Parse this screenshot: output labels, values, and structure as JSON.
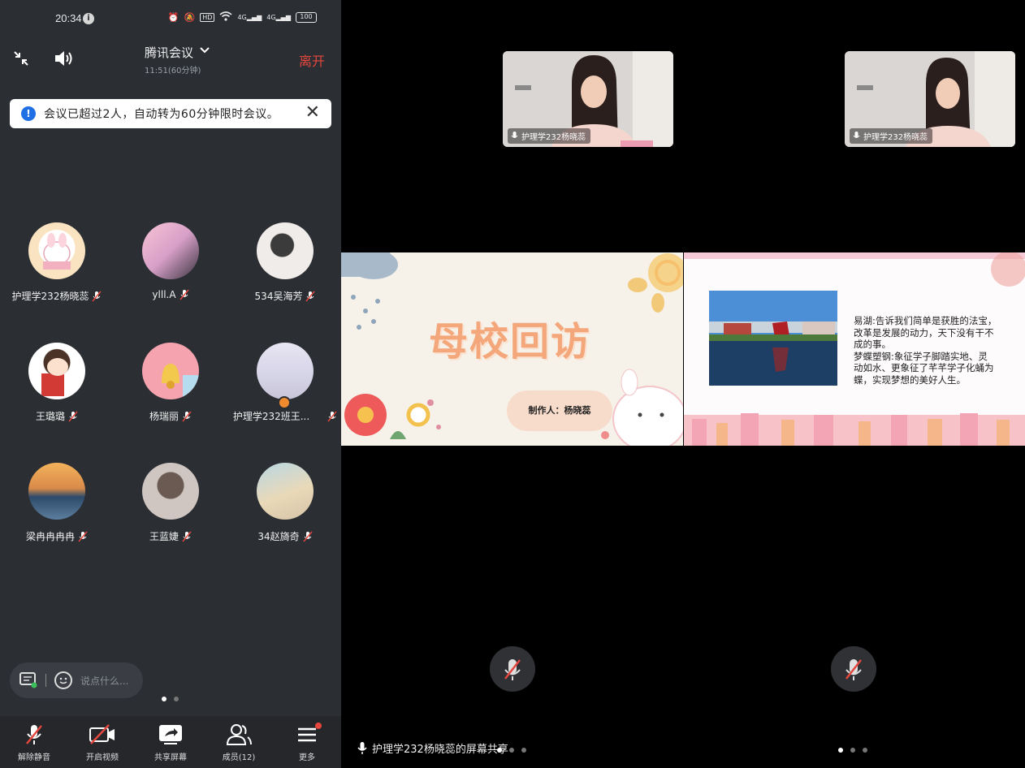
{
  "status_bar": {
    "time": "20:34",
    "hd": "HD",
    "net1": "4G",
    "net2": "4G",
    "battery": "100"
  },
  "header": {
    "title": "腾讯会议",
    "duration": "11:51(60分钟)",
    "leave_label": "离开"
  },
  "notice": {
    "text": "会议已超过2人，自动转为60分钟限时会议。"
  },
  "members": [
    {
      "name": "护理学232杨晓蕊"
    },
    {
      "name": "ylll.A"
    },
    {
      "name": "534吴海芳"
    },
    {
      "name": "王璐璐"
    },
    {
      "name": "杨瑞丽"
    },
    {
      "name": "护理学232班王..."
    },
    {
      "name": "梁冉冉冉冉"
    },
    {
      "name": "王蓝婕"
    },
    {
      "name": "34赵旖奇"
    }
  ],
  "chat": {
    "placeholder": "说点什么..."
  },
  "toolbar": {
    "unmute": "解除静音",
    "video": "开启视频",
    "share": "共享屏幕",
    "members": "成员(12)",
    "more": "更多"
  },
  "video_tiles": [
    {
      "label": "护理学232杨晓蕊"
    },
    {
      "label": "护理学232杨晓蕊"
    }
  ],
  "slides": {
    "left": {
      "title": "母校回访",
      "maker": "制作人：杨晓蕊"
    },
    "right": {
      "text_lines": [
        "易湖:告诉我们简单是获胜的法宝，",
        "改革是发展的动力，天下没有干不",
        "成的事。",
        "梦蝶塑钢:象征学子脚踏实地、灵",
        "动如水、更象征了芊芊学子化蛹为",
        "蝶，实现梦想的美好人生。"
      ]
    }
  },
  "share_label": "护理学232杨晓蕊的屏幕共享",
  "colors": {
    "phone_bg": "#2b2e33",
    "leave": "#e5473e",
    "notice_icon": "#1f6fe5",
    "slide_title": "#f3a77a"
  }
}
